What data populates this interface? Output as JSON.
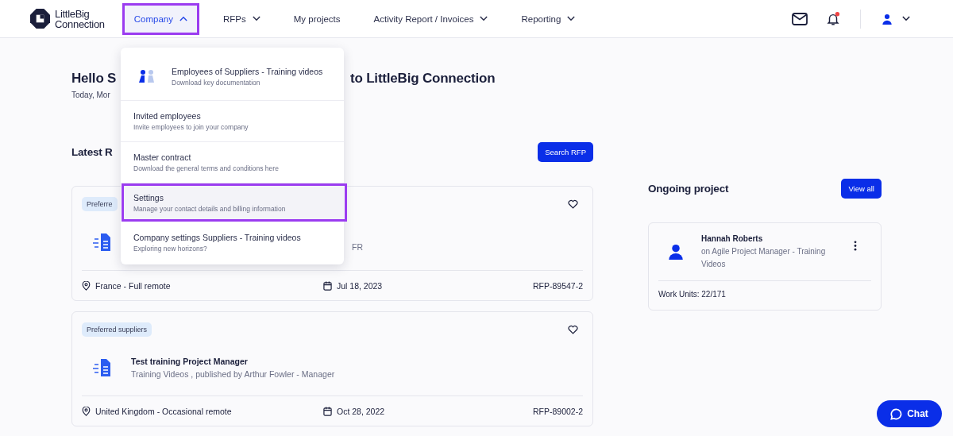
{
  "logo": {
    "line_1": "LittleBig",
    "line_2": "Connection"
  },
  "nav": [
    {
      "label": "Company",
      "selected": true,
      "dropdown": true,
      "expanded": true
    },
    {
      "label": "RFPs",
      "selected": false,
      "dropdown": true,
      "expanded": false
    },
    {
      "label": "My projects",
      "selected": false,
      "dropdown": false
    },
    {
      "label": "Activity Report / Invoices",
      "selected": false,
      "dropdown": true,
      "expanded": false
    },
    {
      "label": "Reporting",
      "selected": false,
      "dropdown": true,
      "expanded": false
    }
  ],
  "notifications": {
    "unread": true
  },
  "company_menu": [
    {
      "title": "Employees of Suppliers - Training videos",
      "subtitle": "Download key documentation",
      "kind": "icon",
      "selected": false
    },
    {
      "title": "Invited employees",
      "subtitle": "Invite employees to join your company",
      "kind": "plain",
      "selected": false
    },
    {
      "title": "Master contract",
      "subtitle": "Download the general terms and conditions here",
      "kind": "plain",
      "selected": false
    },
    {
      "title": "Settings",
      "subtitle": "Manage your contact details and billing information",
      "kind": "plain",
      "selected": true
    },
    {
      "title": "Company settings Suppliers - Training videos",
      "subtitle": "Exploring new horizons?",
      "kind": "plain",
      "selected": false
    }
  ],
  "greeting": {
    "left": "Hello S",
    "right": "to LittleBig Connection",
    "date": "Today, Mor"
  },
  "latest": {
    "title": "Latest R",
    "button": "Search RFP"
  },
  "rfps": [
    {
      "badge": "Preferre",
      "subtitle": "FR",
      "location": "France - Full remote",
      "date": "Jul 18, 2023",
      "ref": "RFP-89547-2",
      "covered": true
    },
    {
      "badge": "Preferred suppliers",
      "title": "Test training Project Manager",
      "subtitle": "Training Videos , published by Arthur Fowler - Manager",
      "location": "United Kingdom - Occasional remote",
      "date": "Oct 28, 2022",
      "ref": "RFP-89002-2",
      "covered": false
    }
  ],
  "ongoing": {
    "title": "Ongoing project",
    "button": "View all",
    "name": "Hannah Roberts",
    "project": "on Agile Project Manager - Training Videos",
    "work_units": "Work Units: 22/171"
  },
  "chat": {
    "label": "Chat"
  }
}
